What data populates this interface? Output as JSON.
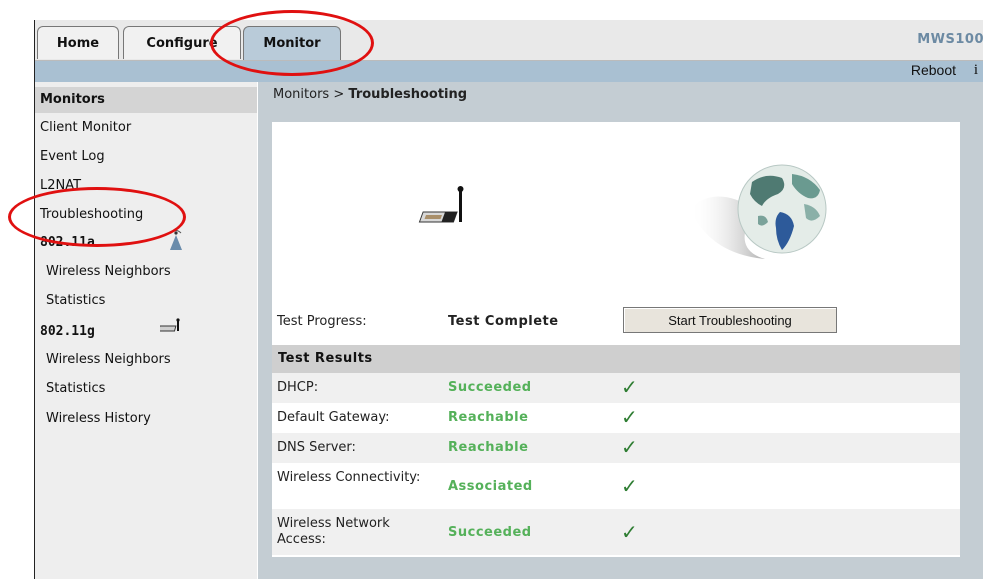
{
  "tabs": [
    {
      "label": "Home",
      "active": false
    },
    {
      "label": "Configure",
      "active": false
    },
    {
      "label": "Monitor",
      "active": true
    }
  ],
  "brand": "MWS100",
  "topbar": {
    "reboot_label": "Reboot",
    "info_glyph": "i"
  },
  "sidebar": {
    "heading": "Monitors",
    "items": [
      "Client Monitor",
      "Event Log",
      "L2NAT",
      "Troubleshooting"
    ],
    "groups": [
      {
        "title": "802.11a",
        "icon": "antenna-icon",
        "items": [
          "Wireless Neighbors",
          "Statistics"
        ]
      },
      {
        "title": "802.11g",
        "icon": "usb-adapter-icon",
        "items": [
          "Wireless Neighbors",
          "Statistics",
          "Wireless History"
        ]
      }
    ]
  },
  "breadcrumb": {
    "parent": "Monitors",
    "separator": " > ",
    "current": "Troubleshooting"
  },
  "progress": {
    "label": "Test Progress:",
    "value": "Test Complete"
  },
  "start_button": "Start Troubleshooting",
  "results": {
    "heading": "Test Results",
    "rows": [
      {
        "label": "DHCP:",
        "value": "Succeeded"
      },
      {
        "label": "Default Gateway:",
        "value": "Reachable"
      },
      {
        "label": "DNS Server:",
        "value": "Reachable"
      },
      {
        "label": "Wireless Connectivity:",
        "value": "Associated"
      },
      {
        "label": "Wireless Network Access:",
        "value": "Succeeded"
      }
    ],
    "check_glyph": "✓"
  },
  "colors": {
    "accent": "#a9c0d2",
    "success": "#55b15a",
    "annotation": "#e01010"
  }
}
